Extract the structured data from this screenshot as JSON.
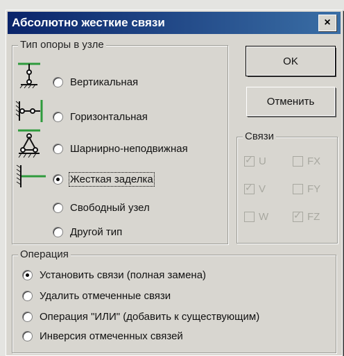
{
  "window": {
    "title": "Абсолютно жесткие связи",
    "close_glyph": "×"
  },
  "support_type": {
    "legend": "Тип опоры в узле",
    "options": [
      {
        "label": "Вертикальная",
        "selected": false,
        "icon": "vertical-support-icon"
      },
      {
        "label": "Горизонтальная",
        "selected": false,
        "icon": "horizontal-support-icon"
      },
      {
        "label": "Шарнирно-неподвижная",
        "selected": false,
        "icon": "pinned-support-icon"
      },
      {
        "label": "Жесткая заделка",
        "selected": true,
        "icon": "fixed-support-icon"
      },
      {
        "label": "Свободный узел",
        "selected": false
      },
      {
        "label": "Другой тип",
        "selected": false
      }
    ]
  },
  "buttons": {
    "ok": "OK",
    "cancel": "Отменить"
  },
  "constraints": {
    "legend": "Связи",
    "items": [
      {
        "label": "U",
        "checked": true
      },
      {
        "label": "FX",
        "checked": false
      },
      {
        "label": "V",
        "checked": true
      },
      {
        "label": "FY",
        "checked": false
      },
      {
        "label": "W",
        "checked": false
      },
      {
        "label": "FZ",
        "checked": true
      }
    ]
  },
  "operation": {
    "legend": "Операция",
    "options": [
      {
        "label": "Установить связи (полная замена)",
        "selected": true
      },
      {
        "label": "Удалить отмеченные связи",
        "selected": false
      },
      {
        "label": "Операция \"ИЛИ\" (добавить к существующим)",
        "selected": false
      },
      {
        "label": "Инверсия отмеченных связей",
        "selected": false
      }
    ]
  },
  "colors": {
    "title_start": "#0a246a",
    "title_end": "#3a6ea5",
    "icon_green": "#2e9b3c"
  }
}
